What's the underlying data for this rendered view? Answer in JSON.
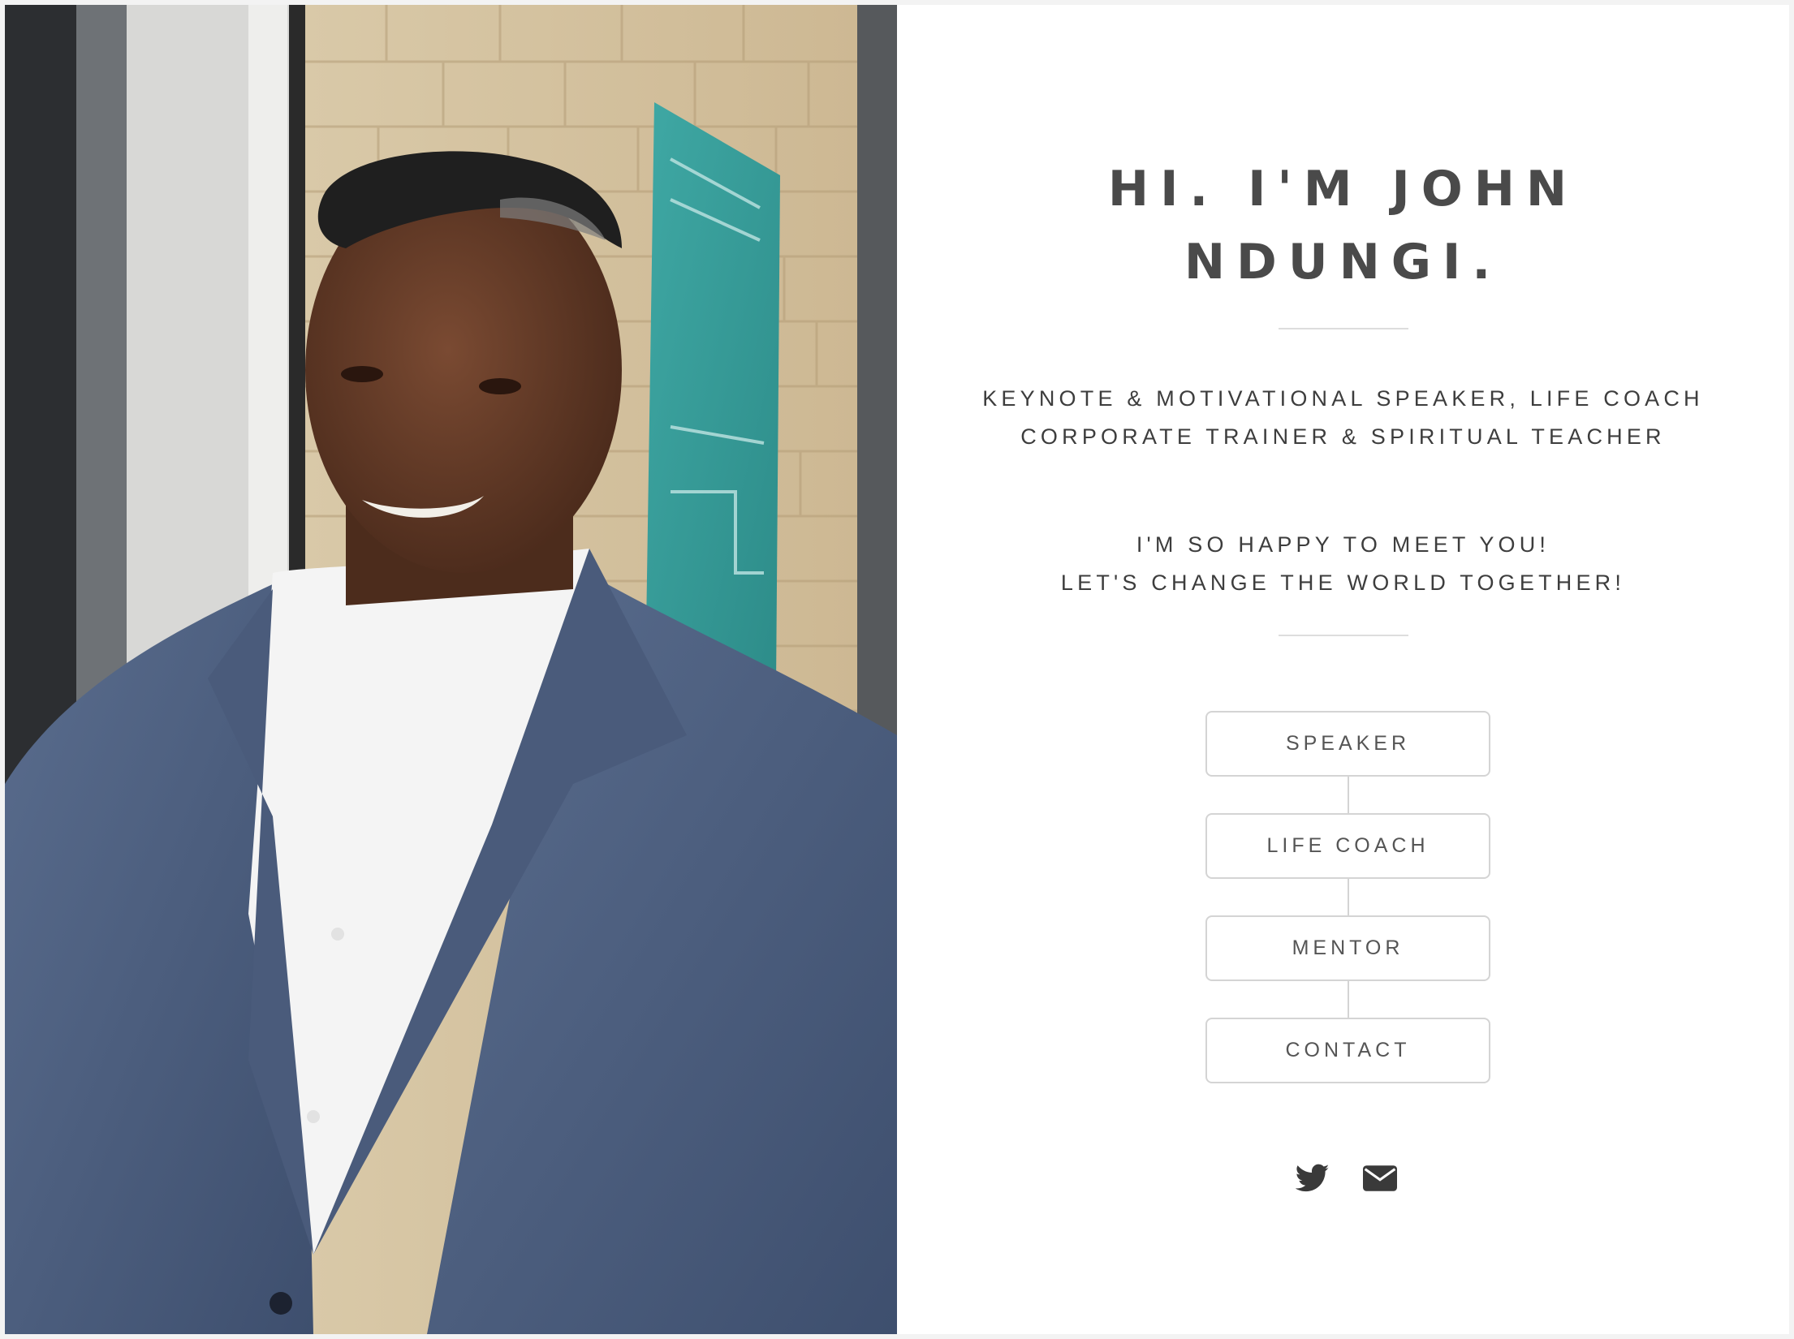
{
  "hero": {
    "title_lines": [
      "HI. I'M JOHN",
      "NDUNGI."
    ],
    "roles_lines": [
      "KEYNOTE & MOTIVATIONAL SPEAKER, LIFE COACH",
      "CORPORATE TRAINER & SPIRITUAL TEACHER"
    ],
    "greeting_lines": [
      "I'M SO HAPPY TO MEET YOU!",
      "LET'S CHANGE THE WORLD TOGETHER!"
    ]
  },
  "nav": {
    "buttons": [
      {
        "label": "SPEAKER"
      },
      {
        "label": "LIFE COACH"
      },
      {
        "label": "MENTOR"
      },
      {
        "label": "CONTACT"
      }
    ]
  },
  "social": {
    "icons": [
      "twitter-icon",
      "envelope-icon"
    ]
  },
  "colors": {
    "text": "#4a4a4a",
    "rule": "#dddddd",
    "button_border": "#d4d4d4",
    "background": "#ffffff"
  }
}
